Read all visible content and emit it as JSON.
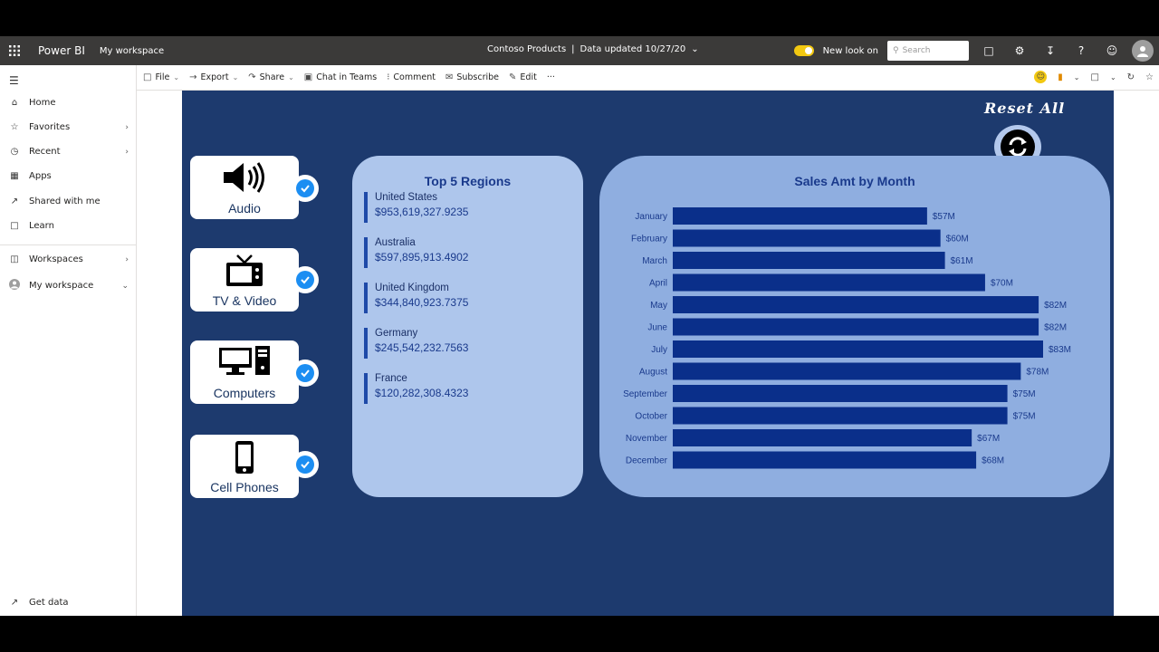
{
  "topbar": {
    "brand": "Power BI",
    "workspace": "My workspace",
    "report_name": "Contoso Products",
    "separator": "|",
    "data_updated": "Data updated 10/27/20",
    "new_look_label": "New look on",
    "search_placeholder": "Search"
  },
  "nav": {
    "items": [
      {
        "label": "Home",
        "icon": "home-icon"
      },
      {
        "label": "Favorites",
        "icon": "star-icon"
      },
      {
        "label": "Recent",
        "icon": "clock-icon"
      },
      {
        "label": "Apps",
        "icon": "apps-icon"
      },
      {
        "label": "Shared with me",
        "icon": "shared-icon"
      },
      {
        "label": "Learn",
        "icon": "book-icon"
      },
      {
        "label": "Workspaces",
        "icon": "workspaces-icon"
      },
      {
        "label": "My workspace",
        "icon": "avatar-icon"
      }
    ],
    "get_data": "Get data"
  },
  "commands": {
    "file": "File",
    "export": "Export",
    "share": "Share",
    "chat": "Chat in Teams",
    "comment": "Comment",
    "subscribe": "Subscribe",
    "edit": "Edit",
    "more": "···"
  },
  "report": {
    "reset_title": "Reset All",
    "categories": [
      {
        "label": "Audio",
        "icon": "speaker-icon",
        "checked": true
      },
      {
        "label": "TV & Video",
        "icon": "tv-icon",
        "checked": true
      },
      {
        "label": "Computers",
        "icon": "computer-icon",
        "checked": true
      },
      {
        "label": "Cell Phones",
        "icon": "phone-icon",
        "checked": true
      }
    ],
    "regions_title": "Top 5 Regions",
    "regions": [
      {
        "name": "United States",
        "value": "$953,619,327.9235"
      },
      {
        "name": "Australia",
        "value": "$597,895,913.4902"
      },
      {
        "name": "United Kingdom",
        "value": "$344,840,923.7375"
      },
      {
        "name": "Germany",
        "value": "$245,542,232.7563"
      },
      {
        "name": "France",
        "value": "$120,282,308.4323"
      }
    ],
    "colors": {
      "canvas": "#1d3a6e",
      "bar": "#0a2f8a",
      "accent": "#1c8ef2",
      "toggle": "#f2c811"
    }
  },
  "chart_data": {
    "type": "bar",
    "orientation": "horizontal",
    "title": "Sales Amt by Month",
    "categories": [
      "January",
      "February",
      "March",
      "April",
      "May",
      "June",
      "July",
      "August",
      "September",
      "October",
      "November",
      "December"
    ],
    "values": [
      57,
      60,
      61,
      70,
      82,
      82,
      83,
      78,
      75,
      75,
      67,
      68
    ],
    "value_labels": [
      "$57M",
      "$60M",
      "$61M",
      "$70M",
      "$82M",
      "$82M",
      "$83M",
      "$78M",
      "$75M",
      "$75M",
      "$67M",
      "$68M"
    ],
    "unit": "$M",
    "xlim": [
      0,
      83
    ]
  }
}
